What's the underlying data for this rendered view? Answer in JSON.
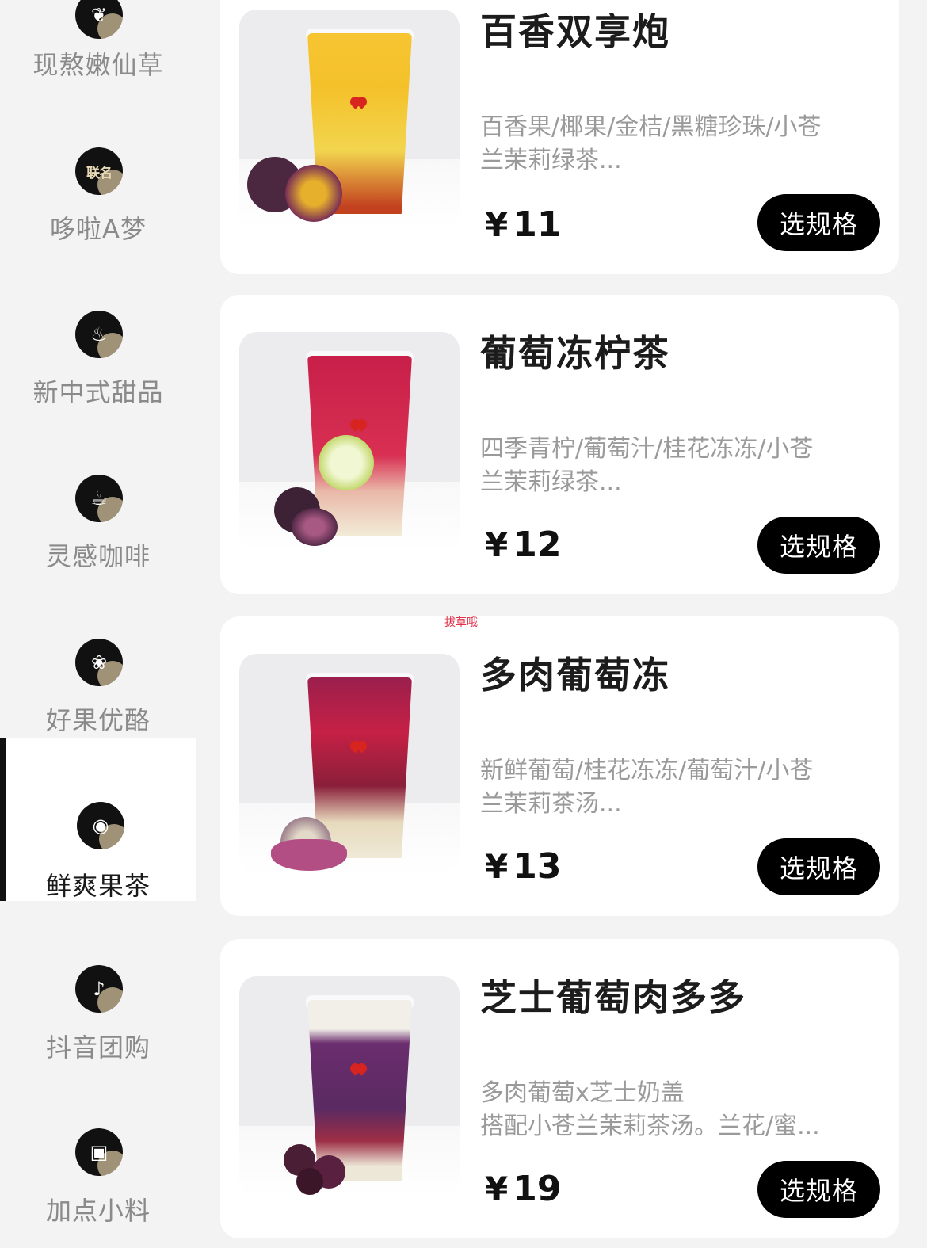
{
  "sidebar": {
    "items": [
      {
        "label": "现熬嫩仙草",
        "icon": "leaf-icon",
        "active": false
      },
      {
        "label": "哆啦A梦",
        "icon": "collab-badge-icon",
        "badge": "联名",
        "active": false
      },
      {
        "label": "新中式甜品",
        "icon": "dessert-icon",
        "active": false
      },
      {
        "label": "灵感咖啡",
        "icon": "coffee-bean-icon",
        "active": false
      },
      {
        "label": "好果优酪",
        "icon": "yogurt-icon",
        "active": false
      },
      {
        "label": "鲜爽果茶",
        "icon": "fruit-tea-icon",
        "active": true
      },
      {
        "label": "抖音团购",
        "icon": "tiktok-icon",
        "active": false
      },
      {
        "label": "加点小料",
        "icon": "toppings-icon",
        "active": false
      }
    ]
  },
  "products": [
    {
      "name": "百香双享炮",
      "desc_line1": "百香果/椰果/金桔/黑糖珍珠/小苍",
      "desc_line2": "兰茉莉绿茶...",
      "currency": "¥",
      "price": "11",
      "button": "选规格",
      "colors": {
        "top": "#f6c531",
        "mid": "#f2d54e",
        "bottom": "#e9cf8c"
      }
    },
    {
      "name": "葡萄冻柠茶",
      "desc_line1": "四季青柠/葡萄汁/桂花冻冻/小苍",
      "desc_line2": "兰茉莉绿茶...",
      "currency": "¥",
      "price": "12",
      "button": "选规格",
      "colors": {
        "top": "#c81f4a",
        "mid": "#d82f52",
        "bottom": "#f2ecd8"
      }
    },
    {
      "name": "多肉葡萄冻",
      "desc_line1": "新鲜葡萄/桂花冻冻/葡萄汁/小苍",
      "desc_line2": "兰茉莉茶汤...",
      "currency": "¥",
      "price": "13",
      "button": "选规格",
      "colors": {
        "top": "#9b1f4d",
        "mid": "#b8233e",
        "bottom": "#efe9d6"
      }
    },
    {
      "name": "芝士葡萄肉多多",
      "desc_line1": "多肉葡萄x芝士奶盖",
      "desc_line2": "搭配小苍兰茉莉茶汤。兰花/蜜...",
      "currency": "¥",
      "price": "19",
      "button": "选规格",
      "colors": {
        "top": "#f2efe9",
        "mid": "#6b2d6e",
        "bottom": "#ece7d7"
      }
    }
  ],
  "watermark": "拔草哦"
}
